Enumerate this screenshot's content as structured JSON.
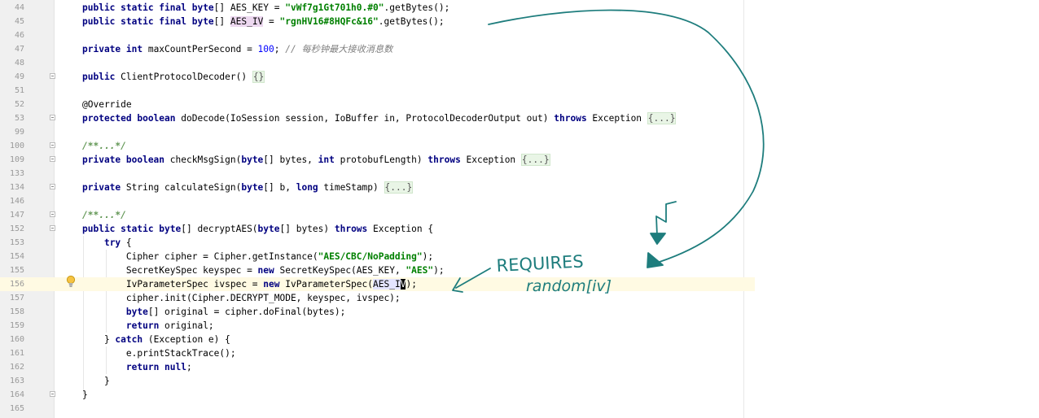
{
  "editor": {
    "lines": [
      {
        "num": "44",
        "segments": [
          {
            "t": "public static final ",
            "c": "kw"
          },
          {
            "t": "byte",
            "c": "kw"
          },
          {
            "t": "[] AES_KEY = "
          },
          {
            "t": "\"vWf7g1Gt701h0.#0\"",
            "c": "str"
          },
          {
            "t": ".getBytes();"
          }
        ]
      },
      {
        "num": "45",
        "segments": [
          {
            "t": "public static final ",
            "c": "kw"
          },
          {
            "t": "byte",
            "c": "kw"
          },
          {
            "t": "[] "
          },
          {
            "t": "AES_IV",
            "c": "hl"
          },
          {
            "t": " = "
          },
          {
            "t": "\"rgnHV16#8HQFc&16\"",
            "c": "str"
          },
          {
            "t": ".getBytes();"
          }
        ]
      },
      {
        "num": "46",
        "segments": []
      },
      {
        "num": "47",
        "segments": [
          {
            "t": "private int ",
            "c": "kw"
          },
          {
            "t": "maxCountPerSecond = "
          },
          {
            "t": "100",
            "c": "num"
          },
          {
            "t": "; "
          },
          {
            "t": "// 每秒钟最大接收消息数",
            "c": "cm"
          }
        ]
      },
      {
        "num": "48",
        "segments": []
      },
      {
        "num": "49",
        "fold": true,
        "segments": [
          {
            "t": "public ",
            "c": "kw"
          },
          {
            "t": "ClientProtocolDecoder() "
          },
          {
            "t": "{}",
            "c": "folded"
          }
        ]
      },
      {
        "num": "51",
        "segments": []
      },
      {
        "num": "52",
        "segments": [
          {
            "t": "@Override"
          }
        ]
      },
      {
        "num": "53",
        "fold": true,
        "segments": [
          {
            "t": "protected boolean ",
            "c": "kw"
          },
          {
            "t": "doDecode(IoSession session, IoBuffer in, ProtocolDecoderOutput out) "
          },
          {
            "t": "throws ",
            "c": "kw"
          },
          {
            "t": "Exception "
          },
          {
            "t": "{...}",
            "c": "folded"
          }
        ]
      },
      {
        "num": "99",
        "segments": []
      },
      {
        "num": "100",
        "fold": true,
        "segments": [
          {
            "t": "/**...*/",
            "c": "doc"
          }
        ]
      },
      {
        "num": "109",
        "fold": true,
        "segments": [
          {
            "t": "private boolean ",
            "c": "kw"
          },
          {
            "t": "checkMsgSign("
          },
          {
            "t": "byte",
            "c": "kw"
          },
          {
            "t": "[] bytes, "
          },
          {
            "t": "int ",
            "c": "kw"
          },
          {
            "t": "protobufLength) "
          },
          {
            "t": "throws ",
            "c": "kw"
          },
          {
            "t": "Exception "
          },
          {
            "t": "{...}",
            "c": "folded"
          }
        ]
      },
      {
        "num": "133",
        "segments": []
      },
      {
        "num": "134",
        "fold": true,
        "segments": [
          {
            "t": "private ",
            "c": "kw"
          },
          {
            "t": "String calculateSign("
          },
          {
            "t": "byte",
            "c": "kw"
          },
          {
            "t": "[] b, "
          },
          {
            "t": "long ",
            "c": "kw"
          },
          {
            "t": "timeStamp) "
          },
          {
            "t": "{...}",
            "c": "folded"
          }
        ]
      },
      {
        "num": "146",
        "segments": []
      },
      {
        "num": "147",
        "fold": true,
        "segments": [
          {
            "t": "/**...*/",
            "c": "doc"
          }
        ]
      },
      {
        "num": "152",
        "fold": true,
        "segments": [
          {
            "t": "public static ",
            "c": "kw"
          },
          {
            "t": "byte",
            "c": "kw"
          },
          {
            "t": "[] decryptAES("
          },
          {
            "t": "byte",
            "c": "kw"
          },
          {
            "t": "[] bytes) "
          },
          {
            "t": "throws ",
            "c": "kw"
          },
          {
            "t": "Exception {"
          }
        ]
      },
      {
        "num": "153",
        "segments": [
          {
            "t": "    "
          },
          {
            "t": "try ",
            "c": "kw"
          },
          {
            "t": "{"
          }
        ]
      },
      {
        "num": "154",
        "segments": [
          {
            "t": "        Cipher cipher = Cipher.getInstance("
          },
          {
            "t": "\"AES/CBC/NoPadding\"",
            "c": "str"
          },
          {
            "t": ");"
          }
        ]
      },
      {
        "num": "155",
        "segments": [
          {
            "t": "        SecretKeySpec keyspec = "
          },
          {
            "t": "new ",
            "c": "kw"
          },
          {
            "t": "SecretKeySpec(AES_KEY, "
          },
          {
            "t": "\"AES\"",
            "c": "str"
          },
          {
            "t": ");"
          }
        ]
      },
      {
        "num": "156",
        "current": true,
        "segments": [
          {
            "t": "        IvParameterSpec ivspec = "
          },
          {
            "t": "new ",
            "c": "kw"
          },
          {
            "t": "IvParameterSpec("
          },
          {
            "t": "AES_I",
            "c": "hlsel"
          },
          {
            "t": "V",
            "c": "caret"
          },
          {
            "t": ");"
          }
        ]
      },
      {
        "num": "157",
        "segments": [
          {
            "t": "        cipher.init(Cipher.DECRYPT_MODE, keyspec, ivspec);"
          }
        ]
      },
      {
        "num": "158",
        "segments": [
          {
            "t": "        "
          },
          {
            "t": "byte",
            "c": "kw"
          },
          {
            "t": "[] original = cipher.doFinal(bytes);"
          }
        ]
      },
      {
        "num": "159",
        "segments": [
          {
            "t": "        "
          },
          {
            "t": "return ",
            "c": "kw"
          },
          {
            "t": "original;"
          }
        ]
      },
      {
        "num": "160",
        "segments": [
          {
            "t": "    } "
          },
          {
            "t": "catch ",
            "c": "kw"
          },
          {
            "t": "(Exception e) {"
          }
        ]
      },
      {
        "num": "161",
        "segments": [
          {
            "t": "        e.printStackTrace();"
          }
        ]
      },
      {
        "num": "162",
        "segments": [
          {
            "t": "        "
          },
          {
            "t": "return null",
            "c": "kw"
          },
          {
            "t": ";"
          }
        ]
      },
      {
        "num": "163",
        "segments": [
          {
            "t": "    }"
          }
        ]
      },
      {
        "num": "164",
        "fold": true,
        "segments": [
          {
            "t": "}"
          }
        ]
      },
      {
        "num": "165",
        "segments": []
      }
    ]
  },
  "annotation": {
    "line1": "REQUIRES",
    "line2": "random[iv]",
    "color": "#1e7d7d"
  },
  "colors": {
    "keyword": "#000080",
    "string": "#008000",
    "comment": "#808080",
    "doc_comment": "#629755",
    "number": "#0000ff",
    "current_line": "#fffae3"
  },
  "icons": {
    "intention": "lightbulb-icon",
    "fold": "fold-marker-icon"
  }
}
